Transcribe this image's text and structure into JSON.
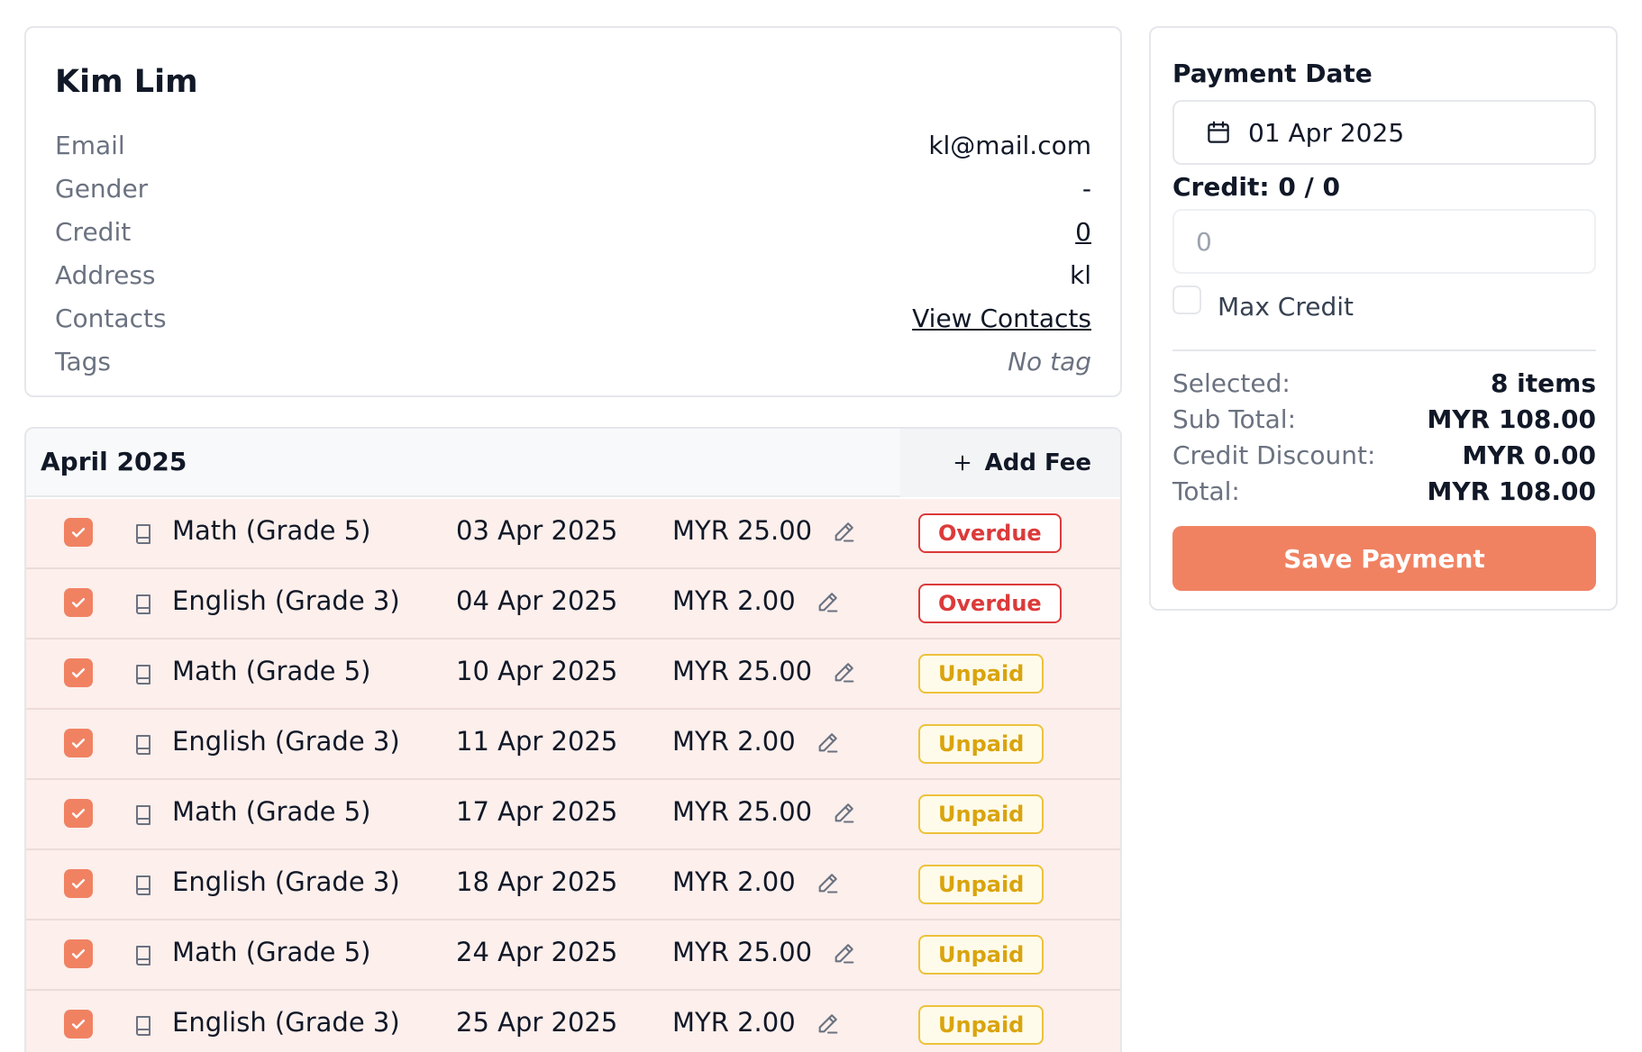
{
  "profile": {
    "name": "Kim Lim",
    "fields": [
      {
        "label": "Email",
        "value": "kl@mail.com"
      },
      {
        "label": "Gender",
        "value": "-"
      },
      {
        "label": "Credit",
        "value": "0"
      },
      {
        "label": "Address",
        "value": "kl"
      },
      {
        "label": "Contacts",
        "value": "View Contacts"
      },
      {
        "label": "Tags",
        "value": "No tag"
      }
    ]
  },
  "fees": {
    "month": "April 2025",
    "add_fee_label": "Add Fee",
    "rows": [
      {
        "name": "Math (Grade 5)",
        "date": "03 Apr 2025",
        "amount": "MYR 25.00",
        "status": "Overdue",
        "checked": true
      },
      {
        "name": "English (Grade 3)",
        "date": "04 Apr 2025",
        "amount": "MYR 2.00",
        "status": "Overdue",
        "checked": true
      },
      {
        "name": "Math (Grade 5)",
        "date": "10 Apr 2025",
        "amount": "MYR 25.00",
        "status": "Unpaid",
        "checked": true
      },
      {
        "name": "English (Grade 3)",
        "date": "11 Apr 2025",
        "amount": "MYR 2.00",
        "status": "Unpaid",
        "checked": true
      },
      {
        "name": "Math (Grade 5)",
        "date": "17 Apr 2025",
        "amount": "MYR 25.00",
        "status": "Unpaid",
        "checked": true
      },
      {
        "name": "English (Grade 3)",
        "date": "18 Apr 2025",
        "amount": "MYR 2.00",
        "status": "Unpaid",
        "checked": true
      },
      {
        "name": "Math (Grade 5)",
        "date": "24 Apr 2025",
        "amount": "MYR 25.00",
        "status": "Unpaid",
        "checked": true
      },
      {
        "name": "English (Grade 3)",
        "date": "25 Apr 2025",
        "amount": "MYR 2.00",
        "status": "Unpaid",
        "checked": true
      }
    ]
  },
  "payment": {
    "date_label": "Payment Date",
    "date_value": "01 Apr 2025",
    "credit_label": "Credit: 0 / 0",
    "credit_placeholder": "0",
    "max_credit_label": "Max Credit",
    "summary": {
      "selected_label": "Selected:",
      "selected_value": "8 items",
      "subtotal_label": "Sub Total:",
      "subtotal_value": "MYR 108.00",
      "discount_label": "Credit Discount:",
      "discount_value": "MYR 0.00",
      "total_label": "Total:",
      "total_value": "MYR 108.00"
    },
    "save_label": "Save Payment"
  },
  "colors": {
    "accent": "#f08262",
    "row_bg": "#fcefec",
    "overdue": "#dc3a3a",
    "unpaid": "#d9a40e"
  },
  "icons": [
    "calendar-icon",
    "plus-icon",
    "book-icon",
    "pencil-icon",
    "check-icon"
  ]
}
